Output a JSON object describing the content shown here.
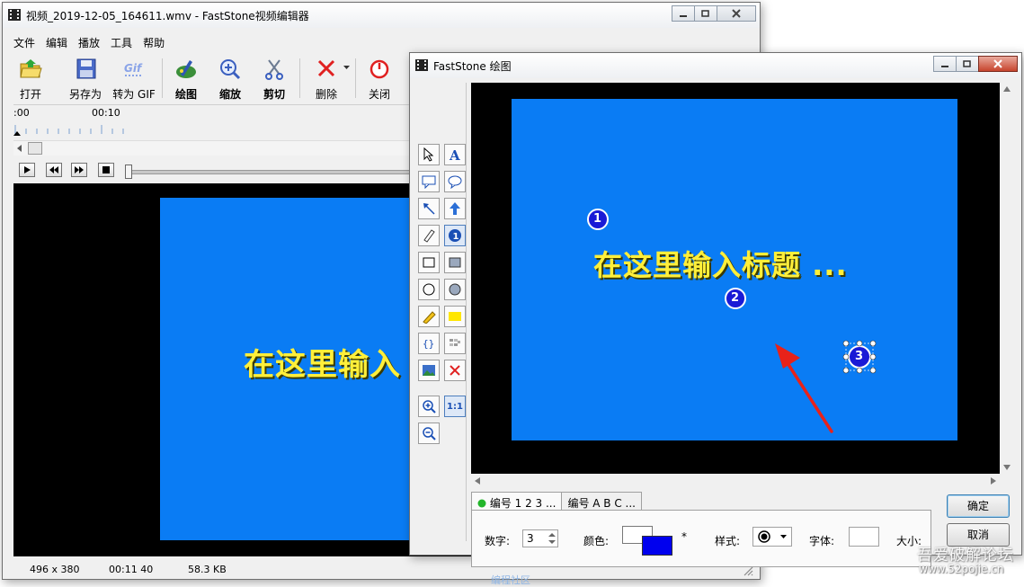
{
  "main_window": {
    "title": "视频_2019-12-05_164611.wmv - FastStone视频编辑器",
    "menu": [
      "文件",
      "编辑",
      "播放",
      "工具",
      "帮助"
    ],
    "toolbar": {
      "open": "打开",
      "save_as": "另存为",
      "to_gif": "转为 GIF",
      "draw": "绘图",
      "zoom": "缩放",
      "cut": "剪切",
      "delete": "删除",
      "close": "关闭"
    },
    "timeline": {
      "start": ":00",
      "mark": "00:10"
    },
    "video_text": "在这里输入",
    "status": {
      "resolution": "496 x 380",
      "duration": "00:11 40",
      "size": "58.3 KB"
    }
  },
  "draw_window": {
    "title": "FastStone 绘图",
    "canvas_title": "在这里输入标题 ...",
    "markers": [
      "1",
      "2",
      "3"
    ],
    "tabs": [
      "编号 1 2 3 ...",
      "编号 A B C ..."
    ],
    "tool_zoom_label": "1:1",
    "panel": {
      "number_label": "数字:",
      "number_value": "3",
      "color_label": "颜色:",
      "asterisk": "*",
      "style_label": "样式:",
      "font_label": "字体:",
      "size_label": "大小:"
    },
    "buttons": {
      "ok": "确定",
      "cancel": "取消"
    }
  },
  "watermark": {
    "line1": "吾爱破解论坛",
    "line2": "www.52pojie.cn",
    "faint": "编程社区"
  },
  "colors": {
    "blue_bg": "#0a7cf4",
    "title_yellow": "#ffef3a",
    "marker_blue": "#1a1ad6",
    "arrow_red": "#e8221a",
    "color_swatch": "#0000ee"
  }
}
